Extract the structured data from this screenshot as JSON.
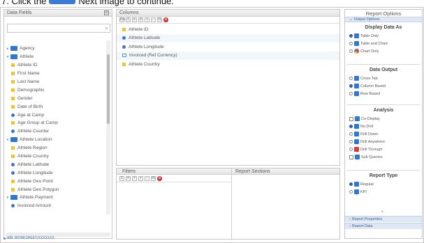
{
  "caption": {
    "prefix": "7. Click the",
    "suffix": "Next image to continue."
  },
  "data_fields": {
    "title": "Data Fields",
    "search_placeholder": "",
    "tree": [
      {
        "label": "Agency",
        "type": "folder",
        "indent": 0,
        "expand": "▸"
      },
      {
        "label": "Athlete",
        "type": "folder",
        "indent": 0,
        "expand": "▾"
      },
      {
        "label": "Athlete ID",
        "type": "dim",
        "indent": 1
      },
      {
        "label": "First Name",
        "type": "dim",
        "indent": 1
      },
      {
        "label": "Last Name",
        "type": "dim",
        "indent": 1
      },
      {
        "label": "Demographic",
        "type": "dim",
        "indent": 1
      },
      {
        "label": "Gender",
        "type": "dim",
        "indent": 1
      },
      {
        "label": "Date of Birth",
        "type": "dim",
        "indent": 1
      },
      {
        "label": "Age at Camp",
        "type": "metric",
        "indent": 1
      },
      {
        "label": "Age Group at Camp",
        "type": "dim",
        "indent": 1
      },
      {
        "label": "Athlete Counter",
        "type": "metric",
        "indent": 1
      },
      {
        "label": "Athlete Location",
        "type": "folder",
        "indent": 0,
        "expand": "▾"
      },
      {
        "label": "Athlete Region",
        "type": "dim",
        "indent": 1
      },
      {
        "label": "Athlete Country",
        "type": "dim",
        "indent": 1
      },
      {
        "label": "Athlete Latitude",
        "type": "metric",
        "indent": 1
      },
      {
        "label": "Athlete Longitude",
        "type": "metric",
        "indent": 1
      },
      {
        "label": "Athlete Geo Point",
        "type": "dim",
        "indent": 1
      },
      {
        "label": "Athlete Geo Polygon",
        "type": "dim",
        "indent": 1
      },
      {
        "label": "Athlete Payment",
        "type": "folder",
        "indent": 0,
        "expand": "▾"
      },
      {
        "label": "Invoiced Amount",
        "type": "metric",
        "indent": 1
      }
    ],
    "footer": "AIB: WORKSHEET/XXXXXXX"
  },
  "columns": {
    "title": "Columns",
    "toolbar": [
      "f(x)",
      "Σ",
      "≡",
      "#",
      "+",
      "−",
      "%"
    ],
    "rows": [
      {
        "label": "Athlete ID",
        "type": "dim"
      },
      {
        "label": "Athlete Latitude",
        "type": "metric"
      },
      {
        "label": "Athlete Longitude",
        "type": "metric"
      },
      {
        "label": "Invoiced (Ref Currency)",
        "type": "calc"
      },
      {
        "label": "Athlete Country",
        "type": "dim"
      }
    ]
  },
  "filters": {
    "title": "Filters",
    "sections_title": "Report Sections",
    "toolbar": [
      "Σ",
      "#",
      "≠",
      "+",
      "−",
      "%"
    ]
  },
  "report_options": {
    "title": "Report Options",
    "output_bar": "Output Options",
    "display_title": "Display Data As",
    "display_options": [
      {
        "label": "Table Only",
        "on": true,
        "icon": "table"
      },
      {
        "label": "Table and Chart",
        "on": false,
        "icon": "table"
      },
      {
        "label": "Chart Only",
        "on": false,
        "icon": "pie"
      }
    ],
    "output_title": "Data Output",
    "output_options": [
      {
        "label": "Cross Tab",
        "on": false
      },
      {
        "label": "Column Based",
        "on": true
      },
      {
        "label": "Row Based",
        "on": false
      }
    ],
    "analysis_title": "Analysis",
    "analysis_options": [
      {
        "label": "Co-Display",
        "kind": "check",
        "on": false
      },
      {
        "label": "No Drill",
        "kind": "radio",
        "on": true
      },
      {
        "label": "Drill Down",
        "kind": "radio",
        "on": false
      },
      {
        "label": "Drill Anywhere",
        "kind": "radio",
        "on": false
      },
      {
        "label": "Drill Through",
        "kind": "radio",
        "on": false,
        "icon": "red"
      },
      {
        "label": "Sub Queries",
        "kind": "check",
        "on": false
      }
    ],
    "type_title": "Report Type",
    "type_options": [
      {
        "label": "Regular",
        "on": true
      },
      {
        "label": "KPI",
        "on": false
      }
    ],
    "bottom_bars": [
      "Report Properties",
      "Report Data"
    ]
  },
  "colors": {
    "folder": "#2f77cf",
    "dimension": "#f2c233",
    "metric": "#3d73c8",
    "accent_bar": "#dfe7f3"
  }
}
